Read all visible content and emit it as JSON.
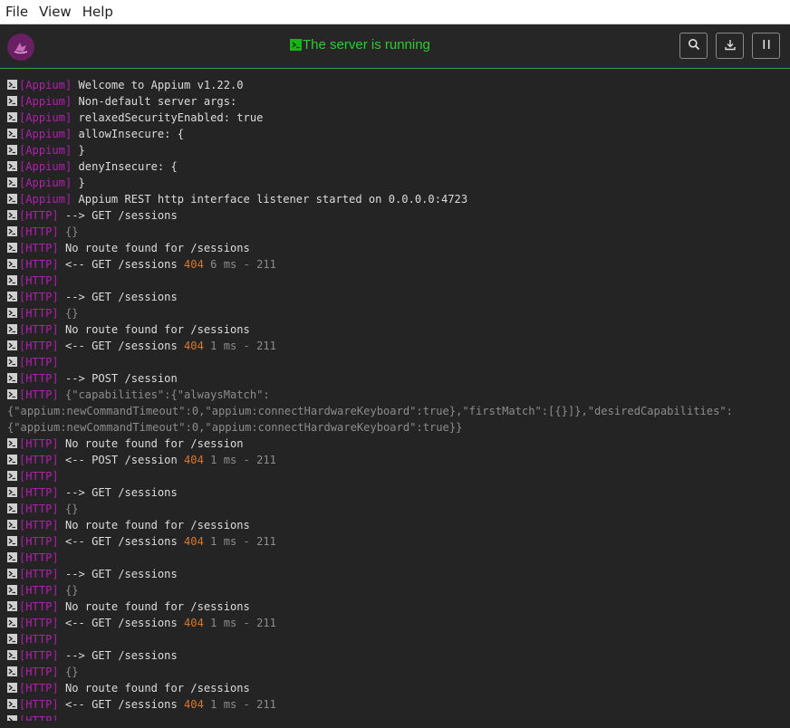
{
  "menu": [
    "File",
    "View",
    "Help"
  ],
  "status_text": "The server is running",
  "toolbar": {
    "search_icon": "search-icon",
    "download_icon": "download-icon",
    "pause_icon": "pause-icon"
  },
  "colors": {
    "tag": "#b11fae",
    "status": "#2ecc2e",
    "http_code": "#d9772b",
    "accent_line": "#3e9b3e"
  },
  "log": [
    {
      "tag": "[Appium]",
      "msg": "Welcome to Appium v1.22.0"
    },
    {
      "tag": "[Appium]",
      "msg": "Non-default server args:"
    },
    {
      "tag": "[Appium]",
      "msg": "  relaxedSecurityEnabled: true"
    },
    {
      "tag": "[Appium]",
      "msg": "  allowInsecure: {"
    },
    {
      "tag": "[Appium]",
      "msg": "  }"
    },
    {
      "tag": "[Appium]",
      "msg": "  denyInsecure: {"
    },
    {
      "tag": "[Appium]",
      "msg": "  }"
    },
    {
      "tag": "[Appium]",
      "msg": "Appium REST http interface listener started on 0.0.0.0:4723"
    },
    {
      "tag": "[HTTP]",
      "msg": "--> GET /sessions"
    },
    {
      "tag": "[HTTP]",
      "dim": "{}"
    },
    {
      "tag": "[HTTP]",
      "msg": "No route found for /sessions"
    },
    {
      "tag": "[HTTP]",
      "msg": "<-- GET /sessions",
      "code": "404",
      "time": "6 ms - 211"
    },
    {
      "tag": "[HTTP]"
    },
    {
      "tag": "[HTTP]",
      "msg": "--> GET /sessions"
    },
    {
      "tag": "[HTTP]",
      "dim": "{}"
    },
    {
      "tag": "[HTTP]",
      "msg": "No route found for /sessions"
    },
    {
      "tag": "[HTTP]",
      "msg": "<-- GET /sessions",
      "code": "404",
      "time": "1 ms - 211"
    },
    {
      "tag": "[HTTP]"
    },
    {
      "tag": "[HTTP]",
      "msg": "--> POST /session"
    },
    {
      "tag": "[HTTP]",
      "dim": "{\"capabilities\":{\"alwaysMatch\":"
    },
    {
      "wrap": "{\"appium:newCommandTimeout\":0,\"appium:connectHardwareKeyboard\":true},\"firstMatch\":[{}]},\"desiredCapabilities\":"
    },
    {
      "wrap": "{\"appium:newCommandTimeout\":0,\"appium:connectHardwareKeyboard\":true}}"
    },
    {
      "tag": "[HTTP]",
      "msg": "No route found for /session"
    },
    {
      "tag": "[HTTP]",
      "msg": "<-- POST /session",
      "code": "404",
      "time": "1 ms - 211"
    },
    {
      "tag": "[HTTP]"
    },
    {
      "tag": "[HTTP]",
      "msg": "--> GET /sessions"
    },
    {
      "tag": "[HTTP]",
      "dim": "{}"
    },
    {
      "tag": "[HTTP]",
      "msg": "No route found for /sessions"
    },
    {
      "tag": "[HTTP]",
      "msg": "<-- GET /sessions",
      "code": "404",
      "time": "1 ms - 211"
    },
    {
      "tag": "[HTTP]"
    },
    {
      "tag": "[HTTP]",
      "msg": "--> GET /sessions"
    },
    {
      "tag": "[HTTP]",
      "dim": "{}"
    },
    {
      "tag": "[HTTP]",
      "msg": "No route found for /sessions"
    },
    {
      "tag": "[HTTP]",
      "msg": "<-- GET /sessions",
      "code": "404",
      "time": "1 ms - 211"
    },
    {
      "tag": "[HTTP]"
    },
    {
      "tag": "[HTTP]",
      "msg": "--> GET /sessions"
    },
    {
      "tag": "[HTTP]",
      "dim": "{}"
    },
    {
      "tag": "[HTTP]",
      "msg": "No route found for /sessions"
    },
    {
      "tag": "[HTTP]",
      "msg": "<-- GET /sessions",
      "code": "404",
      "time": "1 ms - 211"
    },
    {
      "tag": "[HTTP]"
    }
  ]
}
